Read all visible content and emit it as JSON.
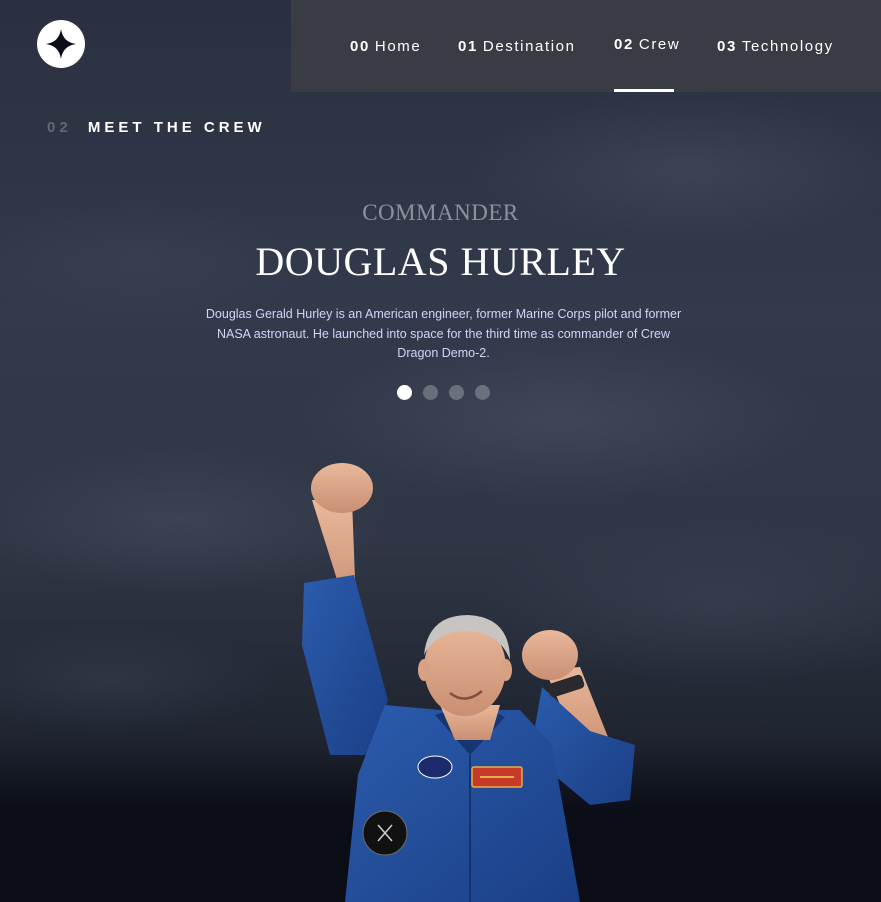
{
  "header": {
    "logo_icon": "star-icon",
    "nav": [
      {
        "num": "00",
        "label": "Home"
      },
      {
        "num": "01",
        "label": "Destination"
      },
      {
        "num": "02",
        "label": "Crew"
      },
      {
        "num": "03",
        "label": "Technology"
      }
    ],
    "active_index": 2
  },
  "page": {
    "num": "02",
    "title": "MEET THE CREW"
  },
  "crew": {
    "role": "COMMANDER",
    "name": "DOUGLAS HURLEY",
    "bio": "Douglas Gerald Hurley is an American engineer, former Marine Corps pilot and former NASA astronaut. He launched into space for the third time as commander of Crew Dragon Demo-2.",
    "slides": 4,
    "active_slide": 0
  },
  "colors": {
    "background": "#0b0d17",
    "nav_bg": "#3c3e46",
    "text_light": "#d0d6f9",
    "accent": "#ffffff"
  }
}
